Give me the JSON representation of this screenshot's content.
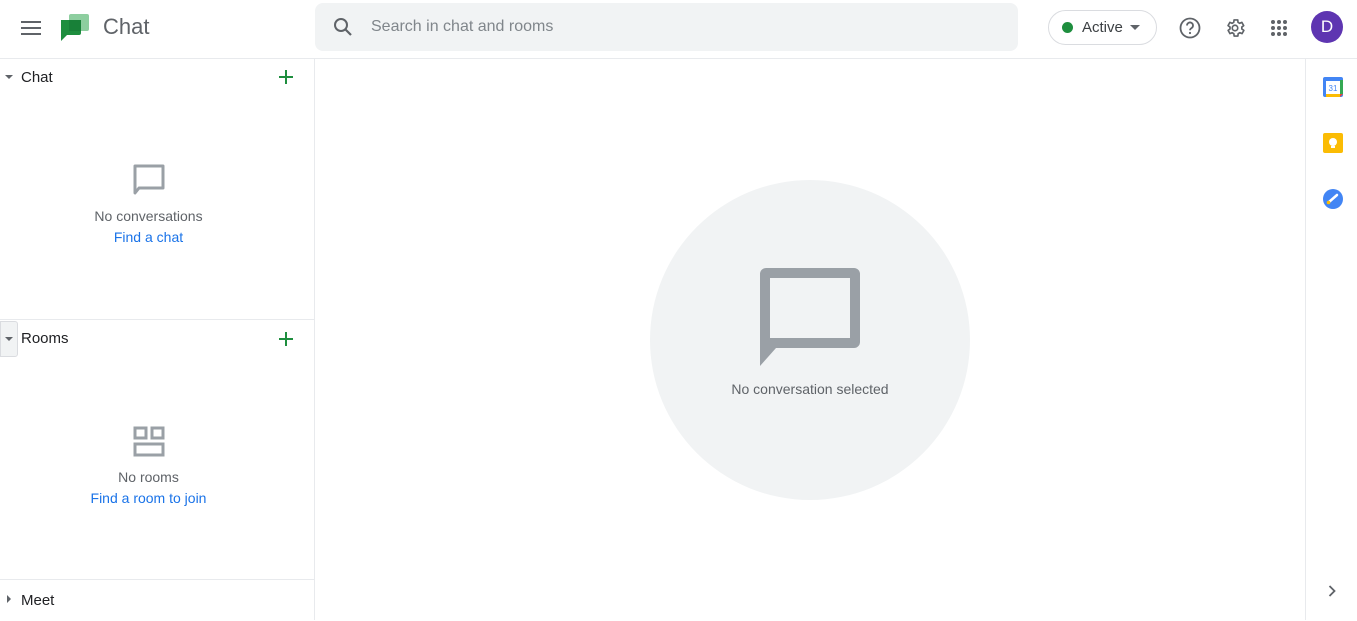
{
  "header": {
    "app_title": "Chat",
    "search_placeholder": "Search in chat and rooms",
    "search_value": "",
    "status_label": "Active",
    "status_color": "#1e8e3e",
    "avatar_initial": "D",
    "avatar_color": "#5e35b1",
    "icons": [
      "menu-icon",
      "google-chat-logo",
      "search-icon",
      "help-icon",
      "settings-icon",
      "apps-grid-icon"
    ]
  },
  "sidebar": {
    "chat": {
      "title": "Chat",
      "empty_text": "No conversations",
      "link_text": "Find a chat"
    },
    "rooms": {
      "title": "Rooms",
      "empty_text": "No rooms",
      "link_text": "Find a room to join"
    },
    "meet": {
      "title": "Meet"
    }
  },
  "main": {
    "empty_state_text": "No conversation selected"
  },
  "side_panel": {
    "apps": [
      {
        "name": "Calendar",
        "label": "31"
      },
      {
        "name": "Keep"
      },
      {
        "name": "Tasks"
      }
    ]
  },
  "colors": {
    "accent_green": "#1e8e3e",
    "link_blue": "#1a73e8",
    "icon_gray": "#9aa0a6"
  }
}
